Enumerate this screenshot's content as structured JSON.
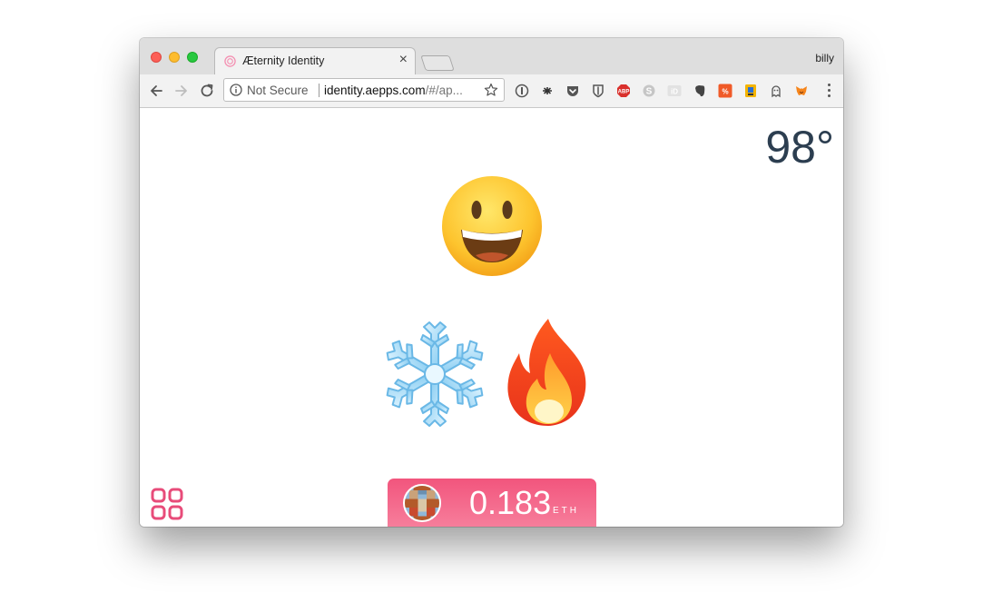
{
  "browser": {
    "tab": {
      "title": "Æternity Identity",
      "close_glyph": "×",
      "favicon": "aeternity-icon"
    },
    "profile_name": "billy",
    "omnibox": {
      "security_label": "Not Secure",
      "url_host": "identity.aepps.com",
      "url_path": "/#/ap..."
    },
    "extensions": [
      "1password-icon",
      "extension-asterisk-icon",
      "pocket-icon",
      "bitwarden-icon",
      "adblock-plus-icon",
      "skype-icon",
      "id-icon",
      "evernote-icon",
      "translate-icon",
      "keep-icon",
      "ghostery-icon",
      "metamask-icon"
    ]
  },
  "app": {
    "temperature": "98°",
    "emoji_main": "grinning-face",
    "emoji_options": [
      "snowflake",
      "fire"
    ],
    "balance": {
      "amount": "0.183",
      "unit": "ETH"
    },
    "colors": {
      "accent": "#f2557d",
      "temperature_text": "#2c3e50"
    }
  }
}
